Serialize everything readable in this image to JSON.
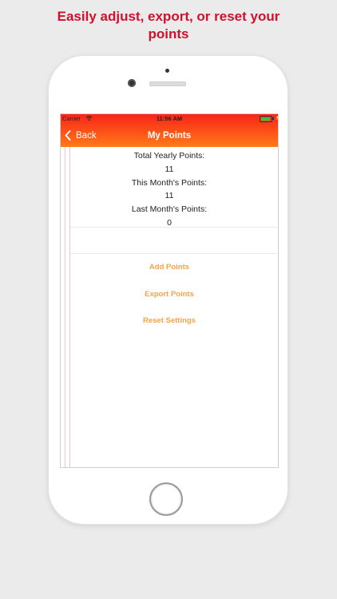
{
  "headline": {
    "line1": "Easily adjust, export, or reset your",
    "line2": "points"
  },
  "status_bar": {
    "carrier": "Carrier",
    "time": "11:56 AM",
    "wifi_icon": "wifi-icon",
    "battery_icon": "battery-icon",
    "battery_level": 0.9,
    "battery_color": "#37c43a"
  },
  "nav": {
    "back_label": "Back",
    "title": "My Points",
    "back_icon": "chevron-left-icon",
    "gradient_top": "#fa2418",
    "gradient_bottom": "#ff7a18"
  },
  "stats": [
    {
      "label": "Total Yearly Points:",
      "value": "11"
    },
    {
      "label": "This Month's Points:",
      "value": "11"
    },
    {
      "label": "Last Month's Points:",
      "value": "0"
    }
  ],
  "actions": {
    "add": "Add Points",
    "export": "Export Points",
    "reset": "Reset Settings",
    "color": "#f5a34a"
  },
  "colors": {
    "headline": "#d0112b",
    "background": "#ebebeb"
  }
}
